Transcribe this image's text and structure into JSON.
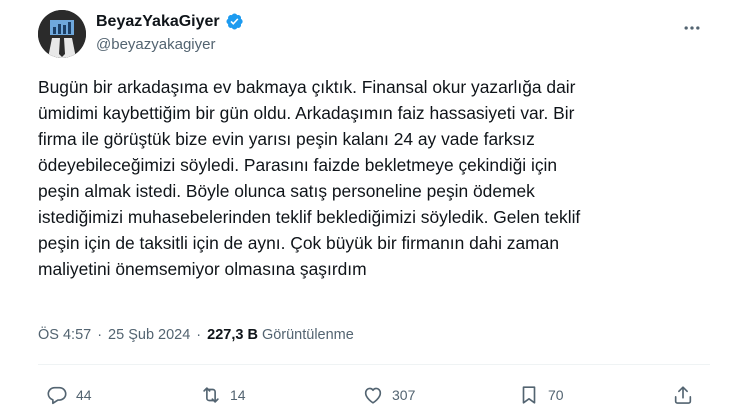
{
  "user": {
    "display_name": "BeyazYakaGiyer",
    "handle": "@beyazyakagiyer",
    "verified": true,
    "verified_color": "#1d9bf0"
  },
  "tweet": {
    "text": "Bugün bir arkadaşıma ev bakmaya çıktık. Finansal okur yazarlığa dair\nümidimi kaybettiğim bir gün oldu. Arkadaşımın faiz hassasiyeti var. Bir\nfirma ile görüştük bize evin yarısı peşin kalanı 24 ay vade farksız\nödeyebileceğimizi söyledi. Parasını faizde bekletmeye çekindiği için\npeşin almak istedi. Böyle olunca satış personeline peşin ödemek\nistediğimizi muhasebelerinden teklif beklediğimizi söyledik. Gelen teklif\npeşin için de taksitli için de aynı. Çok büyük bir firmanın dahi zaman\nmaliyetini önemsemiyor olmasına şaşırdım",
    "time": "ÖS 4:57",
    "date": "25 Şub 2024",
    "views_count": "227,3 B",
    "views_label": "Görüntülenme",
    "separator": "·"
  },
  "actions": {
    "replies": "44",
    "retweets": "14",
    "likes": "307",
    "bookmarks": "70"
  },
  "icons": {
    "more": "more-horizontal-icon",
    "reply": "reply-icon",
    "retweet": "retweet-icon",
    "like": "heart-icon",
    "bookmark": "bookmark-icon",
    "share": "share-icon"
  },
  "colors": {
    "text": "#0f1419",
    "secondary": "#536471",
    "divider": "#eff3f4"
  }
}
